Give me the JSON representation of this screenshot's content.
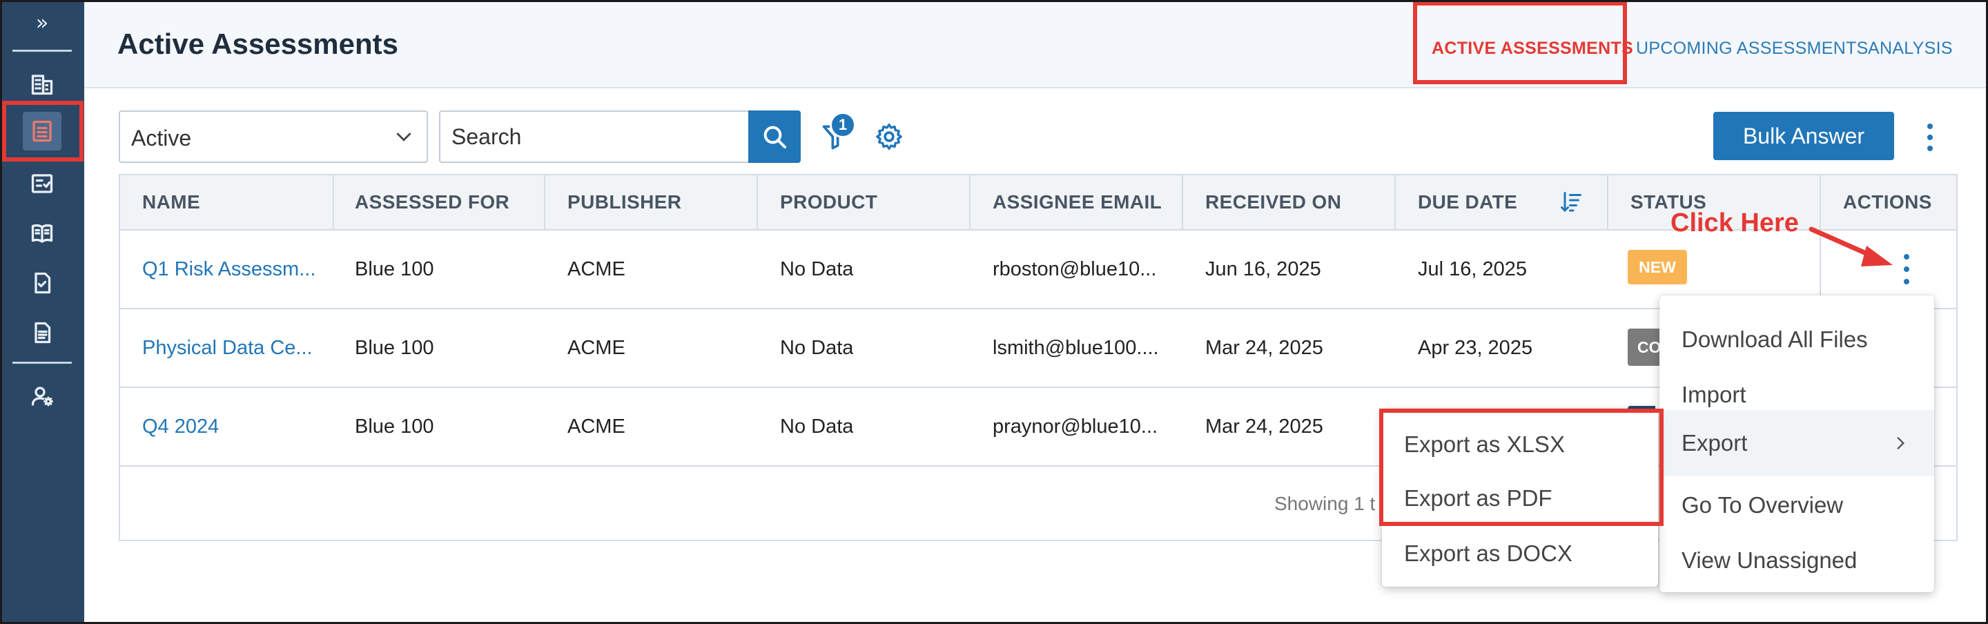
{
  "sidebar": {
    "expand_glyph": "»",
    "items": [
      {
        "name": "building-icon"
      },
      {
        "name": "assessment-list-icon",
        "active": true
      },
      {
        "name": "checklist-icon"
      },
      {
        "name": "book-icon"
      },
      {
        "name": "document-check-icon"
      },
      {
        "name": "document-icon"
      },
      {
        "name": "user-settings-icon"
      }
    ]
  },
  "header": {
    "title": "Active Assessments",
    "tabs": [
      {
        "label": "ACTIVE ASSESSMENTS",
        "active": true
      },
      {
        "label": "UPCOMING ASSESSMENTS",
        "active": false
      },
      {
        "label": "ANALYSIS",
        "active": false
      }
    ]
  },
  "toolbar": {
    "status_filter": "Active",
    "search_placeholder": "Search",
    "filter_count": "1",
    "bulk_answer_label": "Bulk Answer"
  },
  "table": {
    "columns": [
      "NAME",
      "ASSESSED FOR",
      "PUBLISHER",
      "PRODUCT",
      "ASSIGNEE EMAIL",
      "RECEIVED ON",
      "DUE DATE",
      "STATUS",
      "ACTIONS"
    ],
    "rows": [
      {
        "name": "Q1 Risk Assessm...",
        "assessed_for": "Blue 100",
        "publisher": "ACME",
        "product": "No Data",
        "assignee_email": "rboston@blue10...",
        "received_on": "Jun 16, 2025",
        "due_date": "Jul 16, 2025",
        "status": "NEW"
      },
      {
        "name": "Physical Data Ce...",
        "assessed_for": "Blue 100",
        "publisher": "ACME",
        "product": "No Data",
        "assignee_email": "lsmith@blue100....",
        "received_on": "Mar 24, 2025",
        "due_date": "Apr 23, 2025",
        "status": "CO"
      },
      {
        "name": "Q4 2024",
        "assessed_for": "Blue 100",
        "publisher": "ACME",
        "product": "No Data",
        "assignee_email": "praynor@blue10...",
        "received_on": "Mar 24, 2025",
        "due_date": "",
        "status": ""
      }
    ],
    "footer_text": "Showing 1 t"
  },
  "annotation": {
    "text": "Click Here"
  },
  "actions_menu": {
    "items": [
      "Download All Files",
      "Import",
      "Export",
      "Go To Overview",
      "View Unassigned"
    ]
  },
  "export_submenu": {
    "items": [
      "Export as XLSX",
      "Export as PDF",
      "Export as DOCX"
    ]
  },
  "colors": {
    "sidebar": "#2b4766",
    "accent": "#2176b8",
    "highlight": "#e53935",
    "badge_new": "#f9b555"
  }
}
